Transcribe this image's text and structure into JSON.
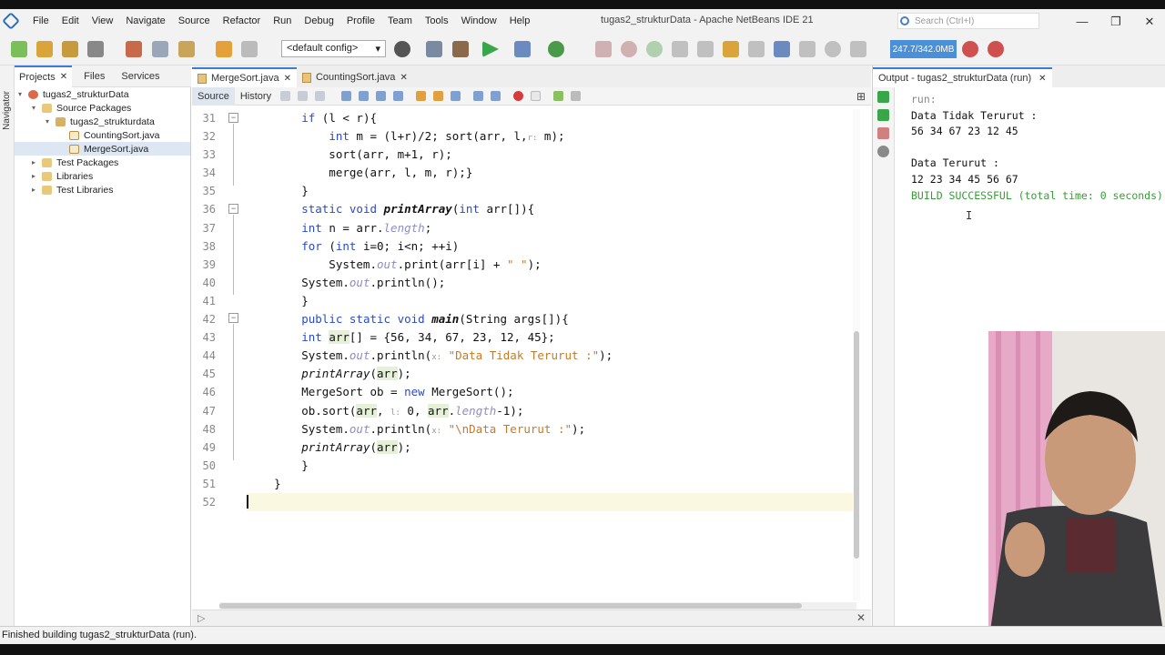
{
  "window": {
    "title": "tugas2_strukturData - Apache NetBeans IDE 21",
    "search_placeholder": "Search (Ctrl+I)",
    "minimize": "—",
    "maximize": "❐",
    "close": "✕"
  },
  "menu": [
    "File",
    "Edit",
    "View",
    "Navigate",
    "Source",
    "Refactor",
    "Run",
    "Debug",
    "Profile",
    "Team",
    "Tools",
    "Window",
    "Help"
  ],
  "toolbar": {
    "config": "<default config>",
    "memory": "247.7/342.0MB"
  },
  "navigator_label": "Navigator",
  "project_panel": {
    "tabs": [
      "Projects",
      "Files",
      "Services"
    ],
    "close_glyph": "✕",
    "tree": [
      {
        "label": "tugas2_strukturData",
        "level": 0,
        "twisty": "▾",
        "type": "project"
      },
      {
        "label": "Source Packages",
        "level": 1,
        "twisty": "▾",
        "type": "folder"
      },
      {
        "label": "tugas2_strukturdata",
        "level": 2,
        "twisty": "▾",
        "type": "package"
      },
      {
        "label": "CountingSort.java",
        "level": 3,
        "twisty": "",
        "type": "file"
      },
      {
        "label": "MergeSort.java",
        "level": 3,
        "twisty": "",
        "type": "file",
        "selected": true
      },
      {
        "label": "Test Packages",
        "level": 1,
        "twisty": "▸",
        "type": "folder"
      },
      {
        "label": "Libraries",
        "level": 1,
        "twisty": "▸",
        "type": "folder"
      },
      {
        "label": "Test Libraries",
        "level": 1,
        "twisty": "▸",
        "type": "folder"
      }
    ]
  },
  "editor": {
    "tabs": [
      {
        "label": "MergeSort.java",
        "active": true
      },
      {
        "label": "CountingSort.java",
        "active": false
      }
    ],
    "close_glyph": "✕",
    "source_label": "Source",
    "history_label": "History",
    "line_numbers": [
      "31",
      "32",
      "33",
      "34",
      "35",
      "36",
      "37",
      "38",
      "39",
      "40",
      "41",
      "42",
      "43",
      "44",
      "45",
      "46",
      "47",
      "48",
      "49",
      "50",
      "51",
      "52"
    ],
    "code_lines": [
      "        if (l < r){",
      "            int m = (l+r)/2; sort(arr, l, r: m);",
      "            sort(arr, m+1, r);",
      "            merge(arr, l, m, r);}",
      "        }",
      "        static void printArray(int arr[]){",
      "        int n = arr.length;",
      "        for (int i=0; i<n; ++i)",
      "            System.out.print(arr[i] + \" \");",
      "        System.out.println();",
      "        }",
      "        public static void main(String args[]){",
      "        int arr[] = {56, 34, 67, 23, 12, 45};",
      "        System.out.println(x: \"Data Tidak Terurut :\");",
      "        printArray(arr);",
      "        MergeSort ob = new MergeSort();",
      "        ob.sort(arr, l: 0, arr.length-1);",
      "        System.out.println(x: \"\\nData Terurut :\");",
      "        printArray(arr);",
      "        }",
      "    }",
      ""
    ]
  },
  "output": {
    "tab_label": "Output - tugas2_strukturData (run)",
    "close_glyph": "✕",
    "lines": [
      "run:",
      "Data Tidak Terurut :",
      "56 34 67 23 12 45",
      "",
      "Data Terurut :",
      "12 23 34 45 56 67",
      "BUILD SUCCESSFUL (total time: 0 seconds)"
    ]
  },
  "status": {
    "message": "Finished building tugas2_strukturData (run)."
  },
  "colors": {
    "keyword": "#2a4ac9",
    "string": "#c47a2a",
    "field": "#8c8cc9",
    "build_success": "#3a9a3a",
    "accent": "#3a7bd5"
  }
}
